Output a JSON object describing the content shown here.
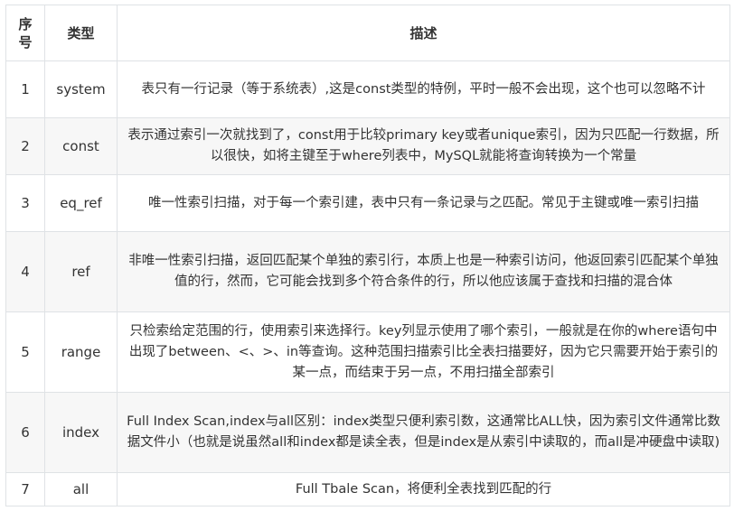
{
  "table": {
    "headers": {
      "index": "序号",
      "type": "类型",
      "description": "描述"
    },
    "rows": [
      {
        "index": "1",
        "type": "system",
        "description": "表只有一行记录（等于系统表）,这是const类型的特例，平时一般不会出现，这个也可以忽略不计"
      },
      {
        "index": "2",
        "type": "const",
        "description": "表示通过索引一次就找到了，const用于比较primary key或者unique索引，因为只匹配一行数据，所以很快，如将主键至于where列表中，MySQL就能将查询转换为一个常量"
      },
      {
        "index": "3",
        "type": "eq_ref",
        "description": "唯一性索引扫描，对于每一个索引建，表中只有一条记录与之匹配。常见于主键或唯一索引扫描"
      },
      {
        "index": "4",
        "type": "ref",
        "description": "非唯一性索引扫描，返回匹配某个单独的索引行，本质上也是一种索引访问，他返回索引匹配某个单独值的行，然而，它可能会找到多个符合条件的行，所以他应该属于查找和扫描的混合体"
      },
      {
        "index": "5",
        "type": "range",
        "description": "只检索给定范围的行，使用索引来选择行。key列显示使用了哪个索引，一般就是在你的where语句中出现了between、<、>、in等查询。这种范围扫描索引比全表扫描要好，因为它只需要开始于索引的某一点，而结束于另一点，不用扫描全部索引"
      },
      {
        "index": "6",
        "type": "index",
        "description": "Full Index Scan,index与all区别：index类型只便利索引数，这通常比ALL快，因为索引文件通常比数据文件小（也就是说虽然all和index都是读全表，但是index是从索引中读取的，而all是冲硬盘中读取)"
      },
      {
        "index": "7",
        "type": "all",
        "description": "Full Tbale Scan，将便利全表找到匹配的行"
      }
    ]
  }
}
